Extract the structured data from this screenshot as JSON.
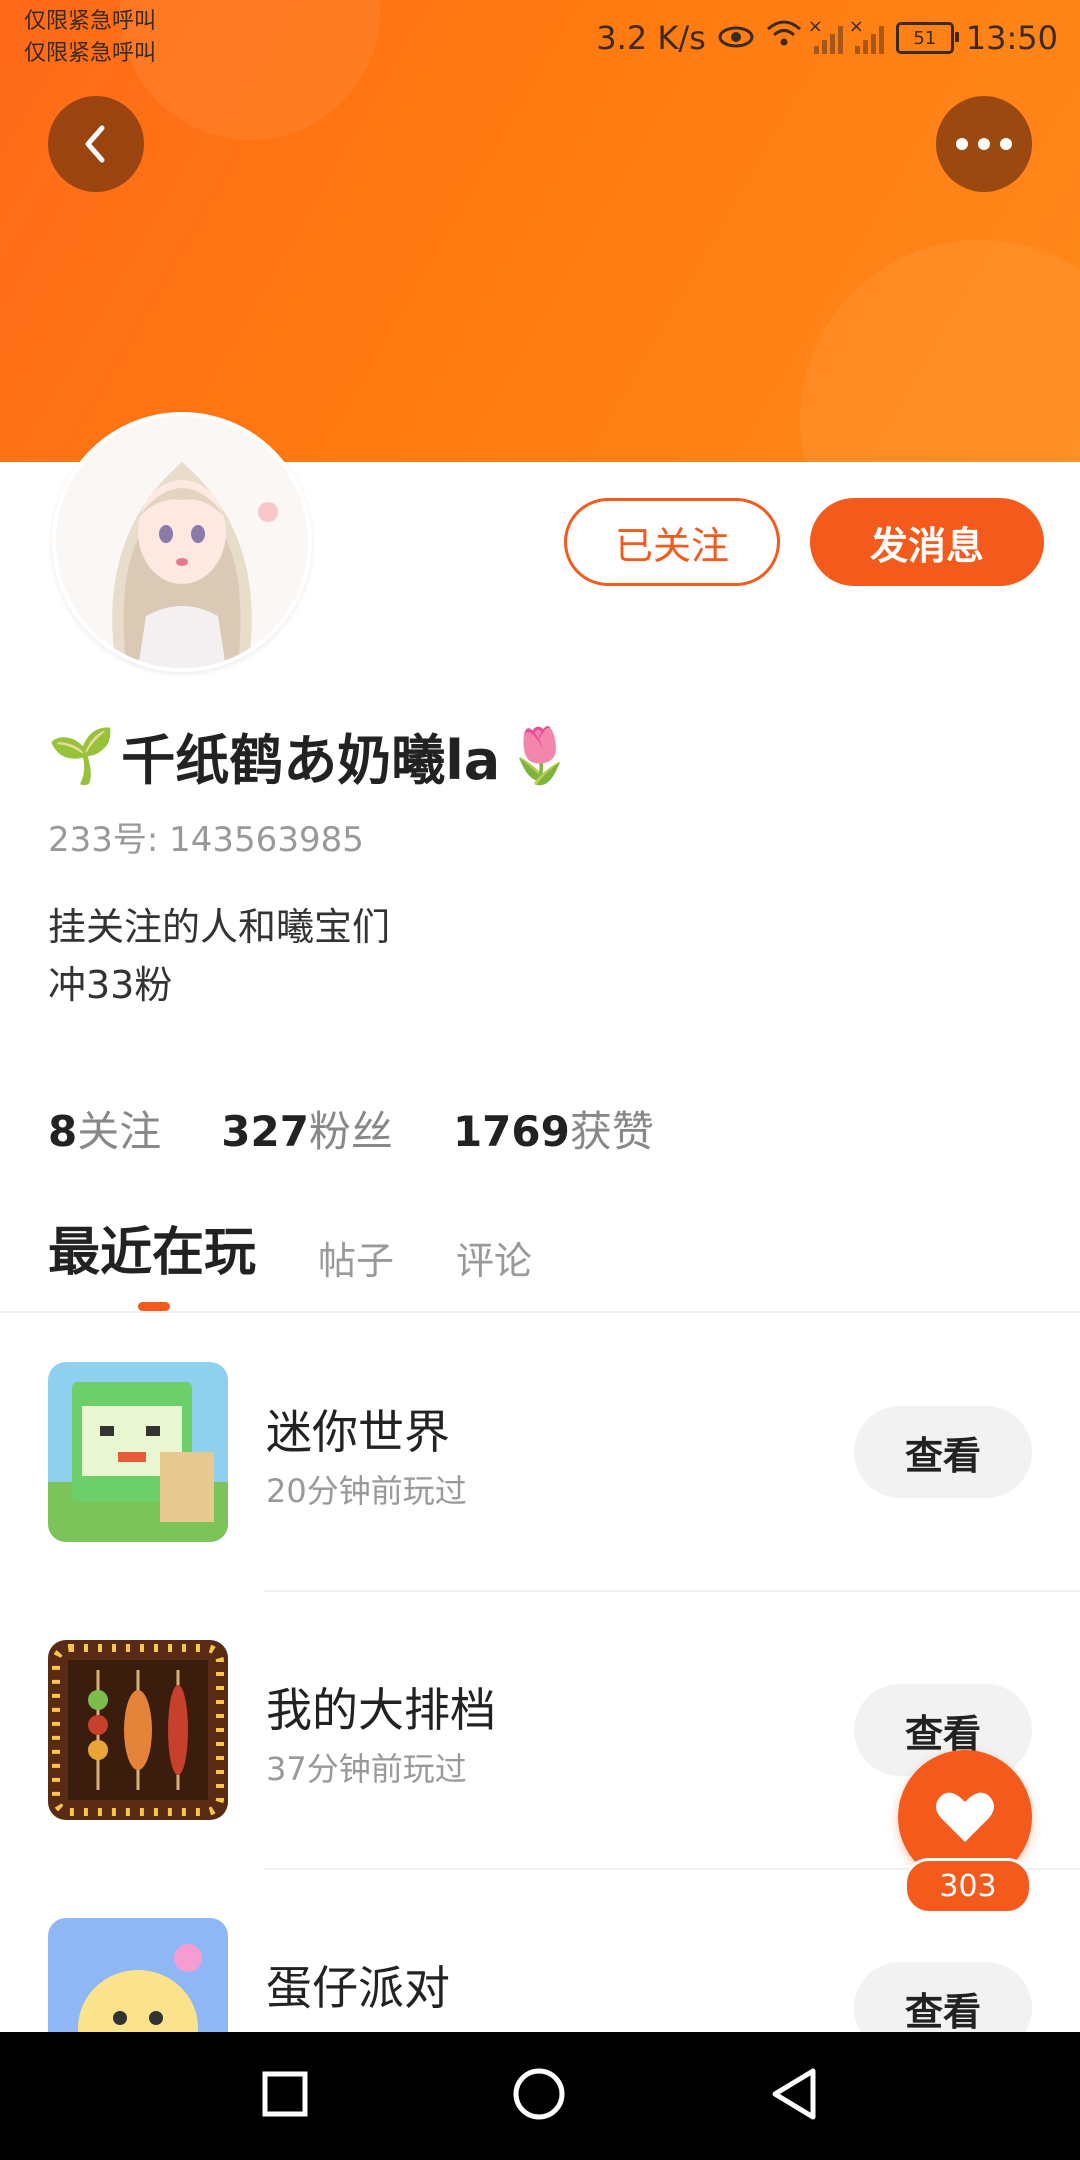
{
  "status_bar": {
    "emergency_line1": "仅限紧急呼叫",
    "emergency_line2": "仅限紧急呼叫",
    "speed": "3.2 K/s",
    "battery": "51",
    "time": "13:50"
  },
  "profile": {
    "username": "千纸鹤あ奶曦la",
    "username_prefix_emoji": "🌱",
    "username_suffix_emoji": "🌷",
    "id_text": "233号: 143563985",
    "bio_line1": "挂关注的人和曦宝们",
    "bio_line2": "冲33粉",
    "follow_label": "已关注",
    "message_label": "发消息"
  },
  "stats": [
    {
      "value": "8",
      "label": "关注"
    },
    {
      "value": "327",
      "label": "粉丝"
    },
    {
      "value": "1769",
      "label": "获赞"
    }
  ],
  "tabs": [
    {
      "label": "最近在玩"
    },
    {
      "label": "帖子"
    },
    {
      "label": "评论"
    }
  ],
  "games": [
    {
      "name": "迷你世界",
      "time": "20分钟前玩过",
      "button": "查看"
    },
    {
      "name": "我的大排档",
      "time": "37分钟前玩过",
      "button": "查看"
    },
    {
      "name": "蛋仔派对",
      "time": "",
      "button": "查看"
    }
  ],
  "like": {
    "count": "303"
  },
  "colors": {
    "accent": "#f35a1c",
    "header": "#ff7a10"
  }
}
